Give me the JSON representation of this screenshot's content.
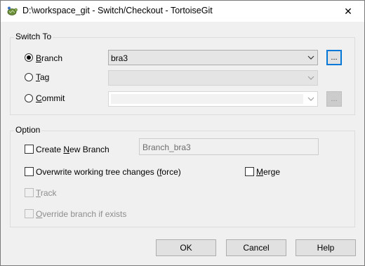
{
  "window": {
    "title": "D:\\workspace_git - Switch/Checkout - TortoiseGit",
    "close_glyph": "✕"
  },
  "switch_to": {
    "legend": "Switch To",
    "branch": {
      "pre": "",
      "mnemonic": "B",
      "post": "ranch",
      "selected": true,
      "value": "bra3"
    },
    "tag": {
      "pre": "",
      "mnemonic": "T",
      "post": "ag",
      "selected": false,
      "value": ""
    },
    "commit": {
      "pre": "",
      "mnemonic": "C",
      "post": "ommit",
      "selected": false,
      "value": ""
    },
    "browse_label": "..."
  },
  "option": {
    "legend": "Option",
    "create_new_branch": {
      "pre": "Create ",
      "mnemonic": "N",
      "post": "ew Branch",
      "checked": false,
      "value": "Branch_bra3"
    },
    "overwrite": {
      "text": "Overwrite working tree changes (",
      "mnemonic": "f",
      "post": "orce)",
      "checked": false
    },
    "merge": {
      "pre": "",
      "mnemonic": "M",
      "post": "erge",
      "checked": false
    },
    "track": {
      "pre": "",
      "mnemonic": "T",
      "post": "rack",
      "checked": false,
      "enabled": false
    },
    "override": {
      "pre": "",
      "mnemonic": "O",
      "post": "verride branch if exists",
      "checked": false,
      "enabled": false
    }
  },
  "buttons": {
    "ok": "OK",
    "cancel": "Cancel",
    "help": "Help"
  }
}
